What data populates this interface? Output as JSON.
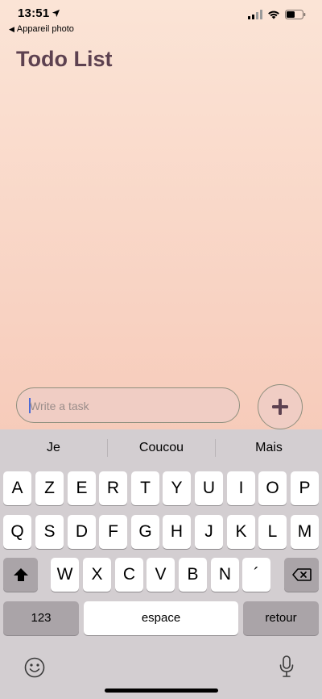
{
  "status_bar": {
    "time": "13:51",
    "back_label": "Appareil photo",
    "icons": [
      "location-arrow-icon",
      "cellular-signal-icon",
      "wifi-icon",
      "battery-icon"
    ]
  },
  "page": {
    "title": "Todo List"
  },
  "task_input": {
    "placeholder": "Write a task",
    "value": ""
  },
  "add_button": {
    "icon": "plus-icon"
  },
  "colors": {
    "title": "#5d4150",
    "keyboard_bg": "#d3ced1",
    "accent_caret": "#4b6ad8"
  },
  "keyboard": {
    "suggestions": [
      "Je",
      "Coucou",
      "Mais"
    ],
    "row1": [
      "A",
      "Z",
      "E",
      "R",
      "T",
      "Y",
      "U",
      "I",
      "O",
      "P"
    ],
    "row2": [
      "Q",
      "S",
      "D",
      "F",
      "G",
      "H",
      "J",
      "K",
      "L",
      "M"
    ],
    "row3": [
      "W",
      "X",
      "C",
      "V",
      "B",
      "N",
      "´"
    ],
    "numbers_label": "123",
    "space_label": "espace",
    "return_label": "retour",
    "icons": [
      "shift-icon",
      "delete-icon",
      "emoji-icon",
      "microphone-icon"
    ]
  }
}
